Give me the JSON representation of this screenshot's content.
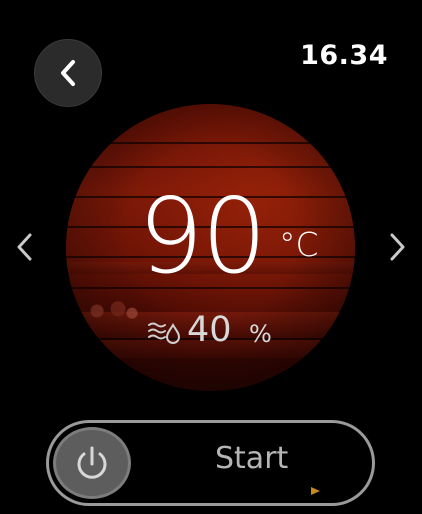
{
  "header": {
    "time": "16.34",
    "back_icon": "chevron-left-icon"
  },
  "navigation": {
    "prev_icon": "chevron-left-icon",
    "next_icon": "chevron-right-icon"
  },
  "sauna": {
    "temperature": "90",
    "temperature_unit": "°C",
    "humidity_icon": "steam-drop-icon",
    "humidity": "40",
    "humidity_unit": "%"
  },
  "start_control": {
    "label": "Start",
    "power_icon": "power-icon",
    "arrow_icon": "arrow-right-icon",
    "arrow_color": "#c8891e"
  },
  "colors": {
    "background": "#000000",
    "disc_tone": "#6a1205",
    "button_bg": "#2b2b2b",
    "slider_border": "#9a9a9a"
  }
}
